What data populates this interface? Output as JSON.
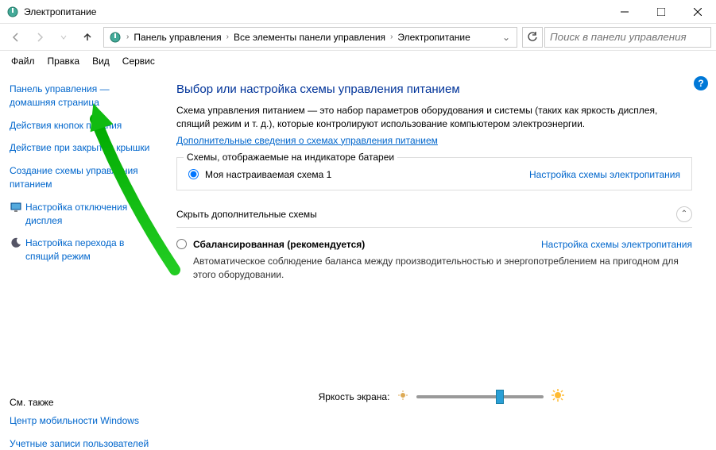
{
  "window": {
    "title": "Электропитание"
  },
  "breadcrumbs": {
    "items": [
      "Панель управления",
      "Все элементы панели управления",
      "Электропитание"
    ]
  },
  "search": {
    "placeholder": "Поиск в панели управления"
  },
  "menu": {
    "file": "Файл",
    "edit": "Правка",
    "view": "Вид",
    "tools": "Сервис"
  },
  "sidebar": {
    "home": "Панель управления — домашняя страница",
    "powerButton": "Действия кнопок питания",
    "lidClose": "Действие при закрытии крышки",
    "createPlan": "Создание схемы управления питанием",
    "displayOff": "Настройка отключения дисплея",
    "sleep": "Настройка перехода в спящий режим",
    "seeAlsoHeader": "См. также",
    "mobility": "Центр мобильности Windows",
    "accounts": "Учетные записи пользователей"
  },
  "main": {
    "heading": "Выбор или настройка схемы управления питанием",
    "description": "Схема управления питанием — это набор параметров оборудования и системы (таких как яркость дисплея, спящий режим и т. д.), которые контролируют использование компьютером электроэнергии.",
    "infoLink": "Дополнительные сведения о схемах управления питанием",
    "batterySection": "Схемы, отображаемые на индикаторе батареи",
    "plan1": {
      "name": "Моя настраиваемая схема 1",
      "link": "Настройка схемы электропитания"
    },
    "hideSection": "Скрыть дополнительные схемы",
    "plan2": {
      "name": "Сбалансированная (рекомендуется)",
      "link": "Настройка схемы электропитания",
      "desc": "Автоматическое соблюдение баланса между производительностью и энергопотреблением на пригодном для этого оборудовании."
    }
  },
  "footer": {
    "brightness": "Яркость экрана:"
  }
}
